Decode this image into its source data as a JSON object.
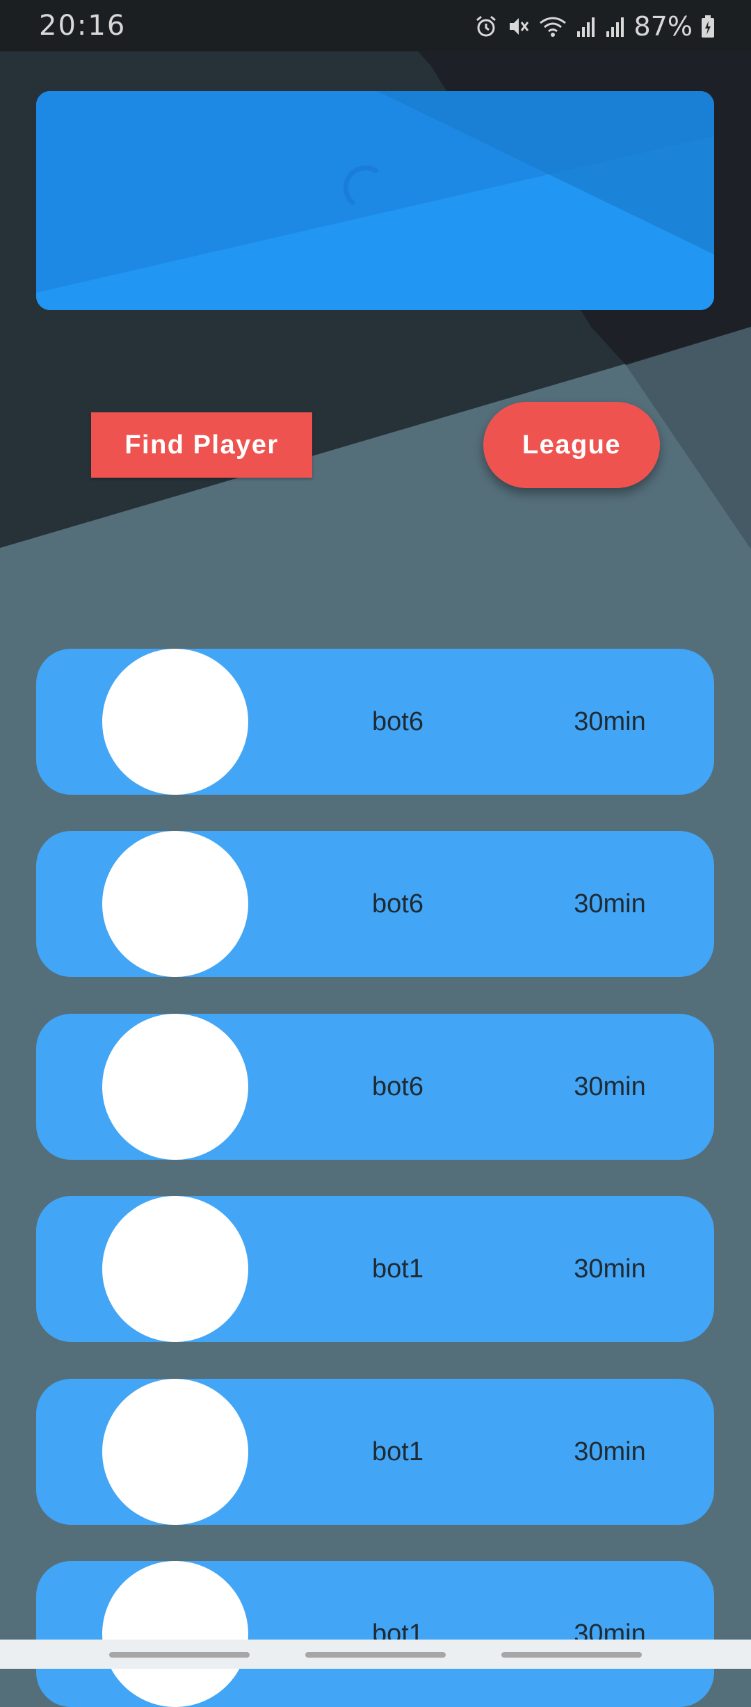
{
  "status_bar": {
    "time": "20:16",
    "battery": "87%",
    "icons": [
      "alarm-icon",
      "mute-icon",
      "wifi-icon",
      "signal-icon",
      "signal-icon-2",
      "battery-icon"
    ]
  },
  "banner": {
    "loading_icon": "spinner-icon",
    "colors": {
      "base": "#2196f3",
      "loader": "#1e88e5"
    }
  },
  "actions": {
    "find_player": "Find Player",
    "league": "League"
  },
  "players": [
    {
      "name": "bot6",
      "time": "30min"
    },
    {
      "name": "bot6",
      "time": "30min"
    },
    {
      "name": "bot6",
      "time": "30min"
    },
    {
      "name": "bot1",
      "time": "30min"
    },
    {
      "name": "bot1",
      "time": "30min"
    },
    {
      "name": "bot1",
      "time": "30min"
    }
  ],
  "colors": {
    "accent": "#ef5350",
    "card": "#42a5f5",
    "background_dark": "#263238",
    "background_light": "#546e7a"
  }
}
